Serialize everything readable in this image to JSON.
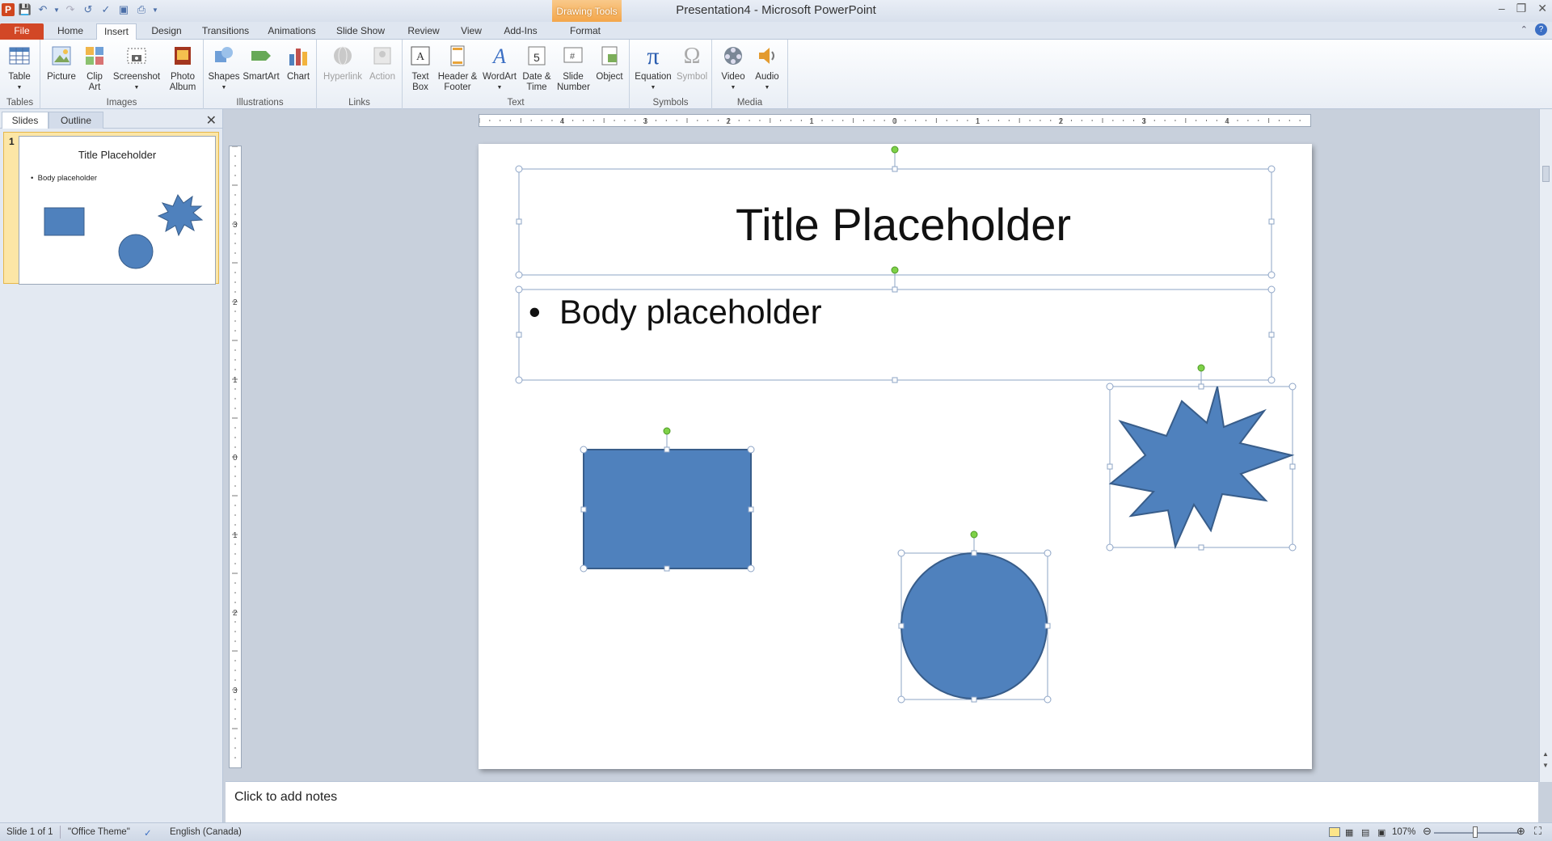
{
  "window": {
    "title": "Presentation4 - Microsoft PowerPoint",
    "context_tab": "Drawing Tools"
  },
  "qat": {
    "icons": [
      "powerpoint-logo",
      "save-icon",
      "undo-icon",
      "redo-icon",
      "repeat-icon",
      "spell-icon",
      "slideshow-icon",
      "print-icon",
      "customize-icon"
    ],
    "logo_letter": "P"
  },
  "tabs": [
    "File",
    "Home",
    "Insert",
    "Design",
    "Transitions",
    "Animations",
    "Slide Show",
    "Review",
    "View",
    "Add-Ins",
    "Format"
  ],
  "ribbon": {
    "groups": [
      {
        "name": "Tables",
        "buttons": [
          {
            "label": "Table",
            "icon": "table-icon"
          }
        ]
      },
      {
        "name": "Images",
        "buttons": [
          {
            "label": "Picture",
            "icon": "picture-icon"
          },
          {
            "label": "Clip Art",
            "icon": "clipart-icon"
          },
          {
            "label": "Screenshot",
            "icon": "screenshot-icon"
          },
          {
            "label": "Photo Album",
            "icon": "photo-album-icon"
          }
        ]
      },
      {
        "name": "Illustrations",
        "buttons": [
          {
            "label": "Shapes",
            "icon": "shapes-icon"
          },
          {
            "label": "SmartArt",
            "icon": "smartart-icon"
          },
          {
            "label": "Chart",
            "icon": "chart-icon"
          }
        ]
      },
      {
        "name": "Links",
        "buttons": [
          {
            "label": "Hyperlink",
            "icon": "hyperlink-icon"
          },
          {
            "label": "Action",
            "icon": "action-icon"
          }
        ]
      },
      {
        "name": "Text",
        "buttons": [
          {
            "label": "Text Box",
            "icon": "textbox-icon"
          },
          {
            "label": "Header & Footer",
            "icon": "header-footer-icon"
          },
          {
            "label": "WordArt",
            "icon": "wordart-icon"
          },
          {
            "label": "Date & Time",
            "icon": "datetime-icon"
          },
          {
            "label": "Slide Number",
            "icon": "slide-number-icon"
          },
          {
            "label": "Object",
            "icon": "object-icon"
          }
        ]
      },
      {
        "name": "Symbols",
        "buttons": [
          {
            "label": "Equation",
            "icon": "equation-icon"
          },
          {
            "label": "Symbol",
            "icon": "symbol-icon"
          }
        ]
      },
      {
        "name": "Media",
        "buttons": [
          {
            "label": "Video",
            "icon": "video-icon"
          },
          {
            "label": "Audio",
            "icon": "audio-icon"
          }
        ]
      }
    ]
  },
  "pane": {
    "tabs": [
      "Slides",
      "Outline"
    ],
    "slide_number": "1",
    "thumb_title": "Title Placeholder",
    "thumb_body": "Body placeholder"
  },
  "ruler": {
    "h_labels": [
      "4",
      "3",
      "2",
      "1",
      "0",
      "1",
      "2",
      "3",
      "4"
    ],
    "v_labels": [
      "3",
      "2",
      "1",
      "0",
      "1",
      "2",
      "3"
    ]
  },
  "slide": {
    "title": "Title Placeholder",
    "body": "Body placeholder",
    "shape_color": "#4f81bd",
    "shape_border": "#385d8a"
  },
  "notes": {
    "placeholder": "Click to add notes"
  },
  "status": {
    "slide": "Slide 1 of 1",
    "theme": "\"Office Theme\"",
    "language": "English (Canada)",
    "zoom": "107%",
    "zoom_value": 1.07
  }
}
